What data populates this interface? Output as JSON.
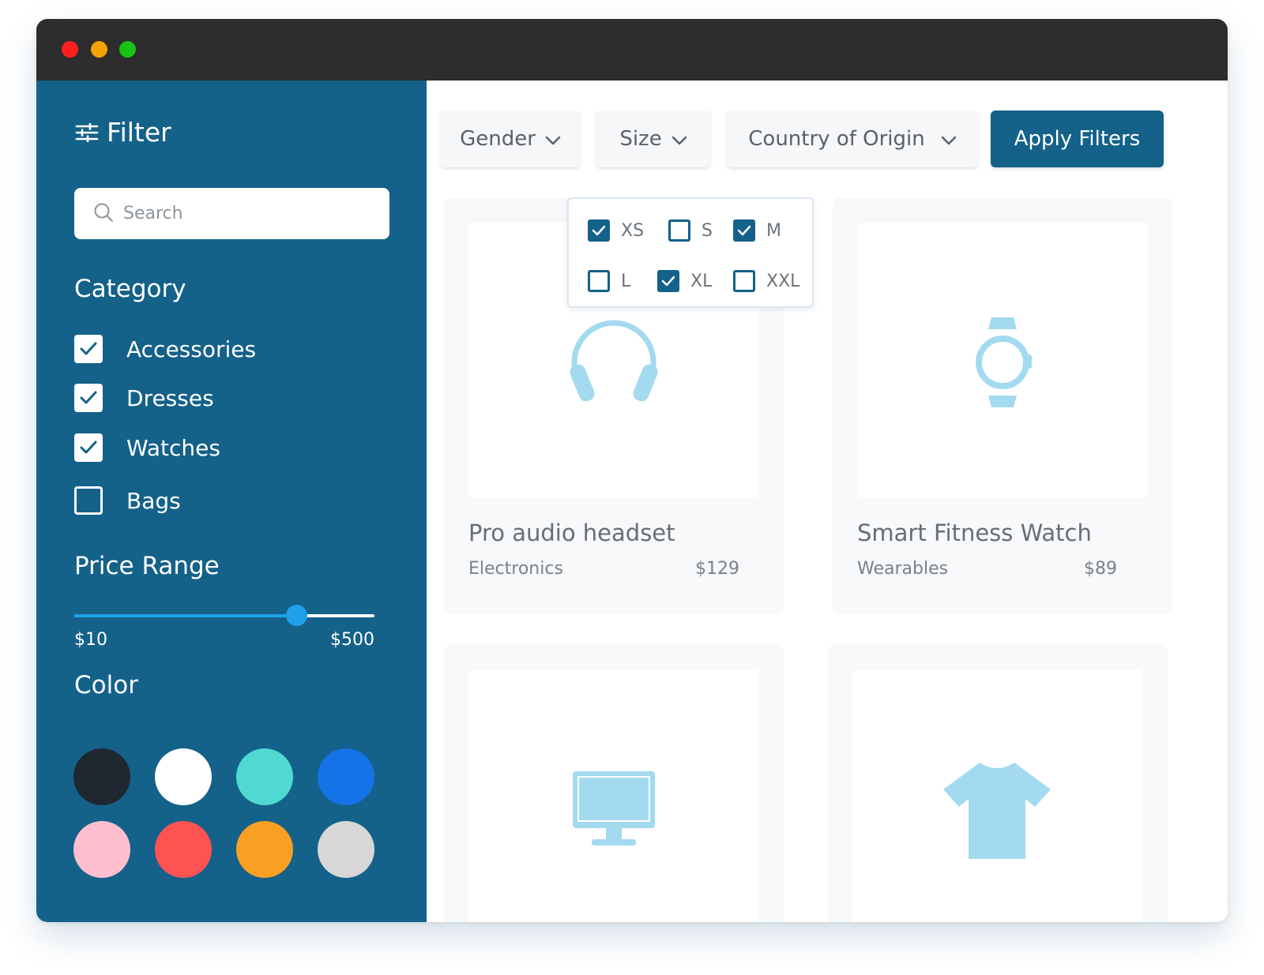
{
  "window": {
    "traffic_lights": [
      "close",
      "minimize",
      "maximize"
    ]
  },
  "sidebar": {
    "title": "Filter",
    "title_icon": "sliders-icon",
    "search": {
      "placeholder": "Search",
      "value": "",
      "icon": "search-icon"
    },
    "category": {
      "heading": "Category",
      "items": [
        {
          "label": "Accessories",
          "checked": true
        },
        {
          "label": "Dresses",
          "checked": true
        },
        {
          "label": "Watches",
          "checked": true
        },
        {
          "label": "Bags",
          "checked": false
        }
      ]
    },
    "price_range": {
      "heading": "Price Range",
      "min_label": "$10",
      "max_label": "$500",
      "value_fraction": 0.74
    },
    "color": {
      "heading": "Color",
      "swatches": [
        "#1f2730",
        "#ffffff",
        "#4fd9d0",
        "#1573e8",
        "#ffbfcf",
        "#ff5252",
        "#f9a022",
        "#d7d7d7"
      ]
    }
  },
  "toolbar": {
    "gender_label": "Gender",
    "size_label": "Size",
    "country_label": "Country of Origin",
    "apply_label": "Apply Filters"
  },
  "size_dropdown": {
    "options": [
      {
        "label": "XS",
        "checked": true
      },
      {
        "label": "S",
        "checked": false
      },
      {
        "label": "M",
        "checked": true
      },
      {
        "label": "L",
        "checked": false
      },
      {
        "label": "XL",
        "checked": true
      },
      {
        "label": "XXL",
        "checked": false
      }
    ]
  },
  "products": [
    {
      "name": "Pro audio headset",
      "category": "Electronics",
      "price": "$129",
      "icon": "headphones-icon"
    },
    {
      "name": "Smart Fitness Watch",
      "category": "Wearables",
      "price": "$89",
      "icon": "smartwatch-icon"
    },
    {
      "name": "",
      "category": "",
      "price": "",
      "icon": "monitor-icon"
    },
    {
      "name": "",
      "category": "",
      "price": "",
      "icon": "tshirt-icon"
    }
  ],
  "colors": {
    "sidebar_bg": "#146189",
    "accent": "#1ea1e6",
    "icon_color": "#a3daf0"
  }
}
